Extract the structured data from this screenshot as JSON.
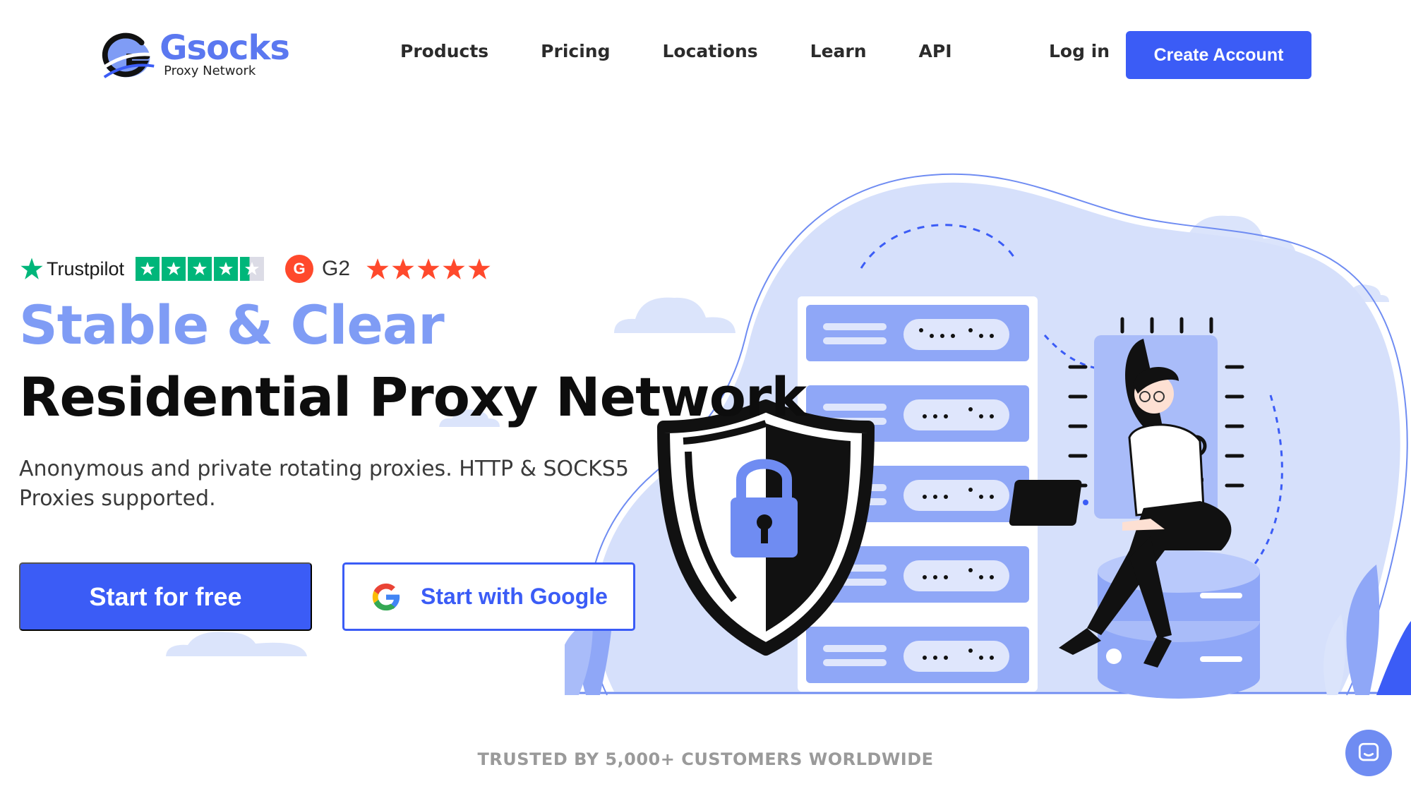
{
  "brand": {
    "name": "Gsocks",
    "tagline": "Proxy Network",
    "primary_color": "#3b5cf6",
    "accent_color": "#7f9cf5"
  },
  "nav": {
    "items": [
      {
        "label": "Products"
      },
      {
        "label": "Pricing"
      },
      {
        "label": "Locations"
      },
      {
        "label": "Learn"
      },
      {
        "label": "API"
      }
    ],
    "login_label": "Log in",
    "create_account_label": "Create Account"
  },
  "ratings": {
    "trustpilot": {
      "name": "Trustpilot",
      "stars": 4.5,
      "max": 5
    },
    "g2": {
      "badge": "G",
      "name": "G2",
      "stars": 5,
      "max": 5
    }
  },
  "hero": {
    "headline_accent": "Stable & Clear",
    "headline_main": "Residential Proxy Network",
    "subtext": "Anonymous and private rotating proxies. HTTP & SOCKS5 Proxies supported.",
    "cta_primary": "Start for free",
    "cta_google": "Start with Google"
  },
  "trusted_text": "TRUSTED BY 5,000+ CUSTOMERS WORLDWIDE",
  "icons": {
    "logo": "gsocks-logo-icon",
    "trustpilot": "trustpilot-star-icon",
    "g2": "g2-logo-icon",
    "google": "google-g-icon",
    "chat": "chat-icon"
  }
}
